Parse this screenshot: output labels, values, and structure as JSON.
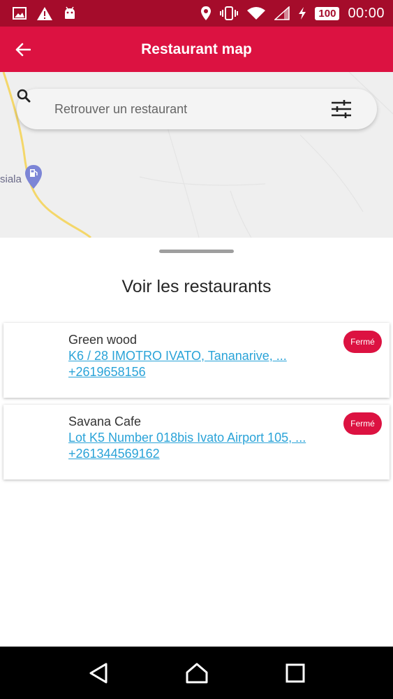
{
  "status_bar": {
    "battery": "100",
    "time": "00:00",
    "icons": [
      "image-icon",
      "warning-icon",
      "android-icon",
      "location-icon",
      "vibrate-icon",
      "wifi-icon",
      "signal-icon",
      "charging-icon"
    ]
  },
  "app_bar": {
    "title": "Restaurant map",
    "back_icon": "arrow-left-icon"
  },
  "map": {
    "place_label": "siala",
    "search": {
      "placeholder": "Retrouver un restaurant",
      "value": ""
    }
  },
  "sheet": {
    "title": "Voir les restaurants"
  },
  "restaurants": [
    {
      "name": "Green wood",
      "address": "K6 / 28 IMOTRO IVATO, Tananarive, ...",
      "phone": "+2619658156",
      "status": "Fermé"
    },
    {
      "name": "Savana Cafe",
      "address": "Lot K5 Number 018bis Ivato Airport 105, ...",
      "phone": "+261344569162",
      "status": "Fermé"
    }
  ],
  "colors": {
    "status_bar": "#a50c2b",
    "primary": "#dc1241",
    "link": "#2aa3d8"
  }
}
